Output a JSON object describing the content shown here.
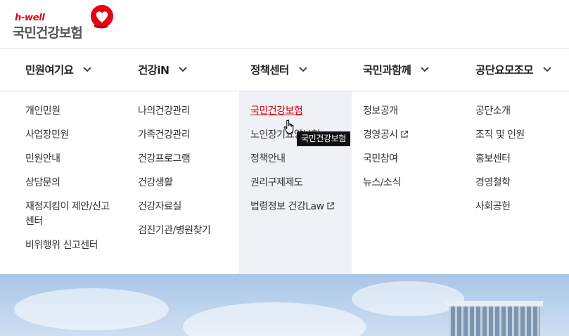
{
  "brand": {
    "tagline": "h-well",
    "name": "국민건강보험",
    "accent": "#e60012"
  },
  "nav": [
    {
      "label": "민원여기요",
      "icon": "chevron-down-icon"
    },
    {
      "label": "건강iN",
      "icon": "chevron-down-icon"
    },
    {
      "label": "정책센터",
      "icon": "chevron-down-icon"
    },
    {
      "label": "국민과함께",
      "icon": "chevron-down-icon"
    },
    {
      "label": "공단요모조모",
      "icon": "chevron-down-icon"
    }
  ],
  "menu": {
    "col1": [
      "개인민원",
      "사업장민원",
      "민원안내",
      "상담문의",
      "재정지킴이 제안/신고센터",
      "비위행위 신고센터"
    ],
    "col2": [
      "나의건강관리",
      "가족건강관리",
      "건강프로그램",
      "건강생활",
      "건강자료실",
      "검진기관/병원찾기"
    ],
    "col3": [
      "국민건강보험",
      "노인장기요양보험",
      "정책안내",
      "권리구제제도",
      "법령정보 건강Law"
    ],
    "col4": [
      "정보공개",
      "경영공시",
      "국민참여",
      "뉴스/소식"
    ],
    "col5": [
      "공단소개",
      "조직 및 인원",
      "홍보센터",
      "경영철학",
      "사회공헌"
    ]
  },
  "tooltip": "국민건강보험",
  "colors": {
    "active_link": "#d90011",
    "highlight_bg": "#eef1f5"
  }
}
